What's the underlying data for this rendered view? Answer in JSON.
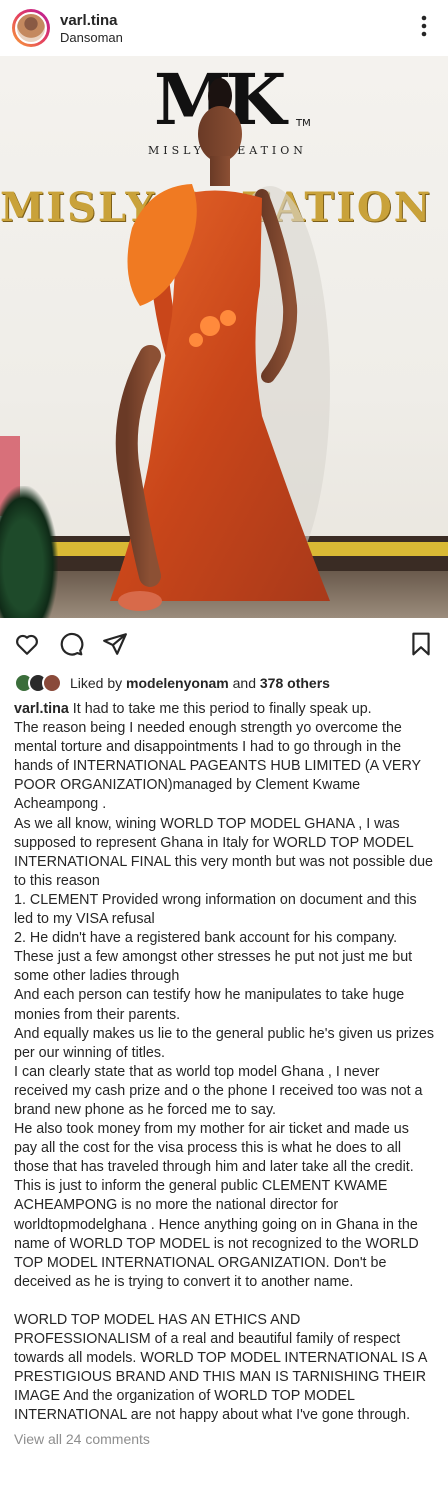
{
  "post": {
    "username": "varl.tina",
    "location": "Dansoman",
    "image": {
      "logo_mark": "MK",
      "logo_tm": "TM",
      "logo_text": "MISLY CREATION",
      "wall_text": "MISLY CREATION"
    }
  },
  "likes": {
    "prefix": "Liked by",
    "user": "modelenyonam",
    "and": "and",
    "others": "378 others"
  },
  "caption": {
    "username": "varl.tina",
    "first_line": " It had to take me this period to finally speak up.",
    "lines": [
      "The reason being I needed enough strength yo overcome the mental torture and disappointments I had to go through in the hands of INTERNATIONAL PAGEANTS HUB LIMITED (A VERY POOR ORGANIZATION)managed by Clement Kwame Acheampong .",
      "As we all know, wining WORLD TOP MODEL GHANA , I was supposed to represent Ghana in Italy for WORLD TOP MODEL INTERNATIONAL FINAL this very month but was not possible due to this reason",
      "1. CLEMENT Provided wrong information on document and this led to my VISA refusal",
      "2. He didn't have a registered bank account for his company.",
      "These just a few amongst other stresses he put not just me but some other ladies through",
      "And each person can testify how he manipulates to take huge monies from their parents.",
      "And equally makes us lie to the general public he's given us prizes per our winning of titles.",
      "I can clearly state that as world top model Ghana , I never received my cash prize and o the phone I received too was not a brand new phone as he forced me to say.",
      "He also took money from my mother for air ticket and made us pay all the cost for the visa process this is what he does to all those that has traveled through him and later take all the credit.",
      "This is just to inform the general public CLEMENT KWAME ACHEAMPONG is no more the national director for worldtopmodelghana . Hence anything going on in Ghana in the name of WORLD TOP MODEL is not recognized to the WORLD TOP MODEL INTERNATIONAL ORGANIZATION. Don't be deceived as he is trying to convert it to another name.",
      "",
      "WORLD TOP MODEL HAS AN ETHICS AND PROFESSIONALISM of a real and beautiful family of respect towards all models. WORLD TOP MODEL INTERNATIONAL IS A PRESTIGIOUS BRAND AND THIS MAN IS TARNISHING THEIR IMAGE And the organization of WORLD TOP MODEL INTERNATIONAL are not happy about what I've gone through."
    ]
  },
  "comments": {
    "view_all": "View all 24 comments"
  },
  "icons": {
    "more": "more-vertical-icon",
    "like": "heart-icon",
    "comment": "comment-icon",
    "share": "send-icon",
    "save": "bookmark-icon"
  },
  "colors": {
    "text": "#262626",
    "muted": "#8e8e8e",
    "dress": "#d4521e",
    "gold": "#c9a23a"
  }
}
